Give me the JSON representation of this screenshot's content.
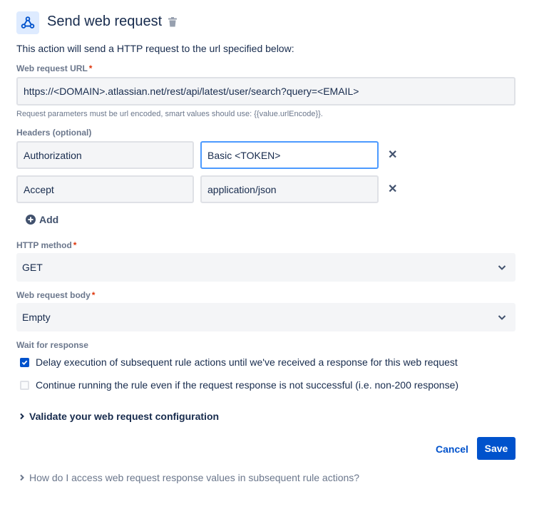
{
  "header": {
    "title": "Send web request",
    "icon": "webhook-icon",
    "delete_icon": "trash-icon"
  },
  "description": "This action will send a HTTP request to the url specified below:",
  "url": {
    "label": "Web request URL",
    "required_mark": "*",
    "value": "https://<DOMAIN>.atlassian.net/rest/api/latest/user/search?query=<EMAIL>",
    "hint": "Request parameters must be url encoded, smart values should use: {{value.urlEncode}}."
  },
  "headers": {
    "label": "Headers (optional)",
    "rows": [
      {
        "name": "Authorization",
        "value": "Basic <TOKEN>"
      },
      {
        "name": "Accept",
        "value": "application/json"
      }
    ],
    "remove_glyph": "✕",
    "add_label": "Add"
  },
  "http_method": {
    "label": "HTTP method",
    "required_mark": "*",
    "value": "GET"
  },
  "body": {
    "label": "Web request body",
    "required_mark": "*",
    "value": "Empty"
  },
  "wait": {
    "label": "Wait for response",
    "options": [
      {
        "label": "Delay execution of subsequent rule actions until we've received a response for this web request",
        "checked": true
      },
      {
        "label": "Continue running the rule even if the request response is not successful (i.e. non-200 response)",
        "checked": false
      }
    ]
  },
  "validate_label": "Validate your web request configuration",
  "actions": {
    "cancel": "Cancel",
    "save": "Save"
  },
  "help_label": "How do I access web request response values in subsequent rule actions?",
  "colors": {
    "primary": "#0052cc",
    "required": "#de350b",
    "focus_border": "#4c9aff"
  }
}
